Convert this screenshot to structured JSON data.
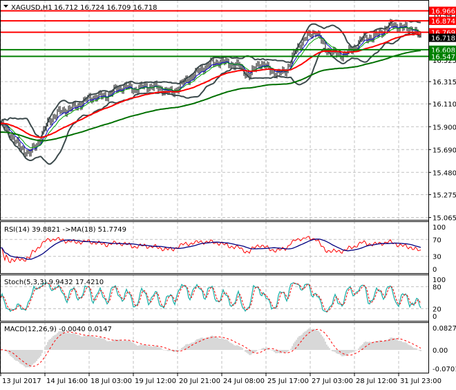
{
  "header": {
    "symbol": "XAGUSD,H1",
    "ohlc": "16.712 16.724 16.709 16.718",
    "menu_icon": "triangle-down-icon"
  },
  "colors": {
    "resistance": "#ff0000",
    "support": "#008000",
    "current_price_bg": "#000000",
    "bars": "#000000",
    "bollinger": "#3c4a4c",
    "ma_fast": "#ff0000",
    "ma_slow": "#007000",
    "rsi": "#ff0000",
    "rsi_ma": "#000080",
    "stoch_main": "#20b2aa",
    "stoch_signal": "#ff0000",
    "macd_hist": "#b0b0b0",
    "macd_signal": "#ff0000"
  },
  "price_axis": {
    "ticks": [
      "16.315",
      "16.110",
      "15.900",
      "15.690",
      "15.480",
      "15.275",
      "15.065"
    ],
    "hidden_ticks": [
      "16.945",
      "16.525"
    ]
  },
  "levels": [
    {
      "label": "16.966",
      "price": 16.966,
      "kind": "resistance"
    },
    {
      "label": "16.874",
      "price": 16.874,
      "kind": "resistance"
    },
    {
      "label": "16.769",
      "price": 16.769,
      "kind": "resistance"
    },
    {
      "label": "16.718",
      "price": 16.718,
      "kind": "current"
    },
    {
      "label": "16.608",
      "price": 16.608,
      "kind": "support"
    },
    {
      "label": "16.547",
      "price": 16.547,
      "kind": "support"
    }
  ],
  "time_axis": [
    "13 Jul 2017",
    "14 Jul 16:00",
    "18 Jul 03:00",
    "19 Jul 12:00",
    "20 Jul 21:00",
    "24 Jul 08:00",
    "25 Jul 17:00",
    "27 Jul 03:00",
    "28 Jul 12:00",
    "31 Jul 23:00"
  ],
  "rsi": {
    "label": "RSI(14) 39.8821  ->MA(18) 51.7749",
    "ticks": [
      "100",
      "70",
      "30",
      "0"
    ]
  },
  "stoch": {
    "label": "Stoch(5,3,3) 9.9432 17.4210",
    "ticks": [
      "100",
      "80",
      "20",
      "0"
    ]
  },
  "macd": {
    "label": "MACD(12,26,9) -0.0040 0.0147",
    "ticks": [
      "0.0827",
      "0.00",
      "-0.0701"
    ]
  },
  "chart_data": {
    "type": "ohlc",
    "symbol": "XAGUSD",
    "timeframe": "H1",
    "ylim": [
      15.065,
      16.966
    ],
    "grid": true,
    "close_samples": [
      15.93,
      15.83,
      15.71,
      15.65,
      15.77,
      15.95,
      16.03,
      16.06,
      16.09,
      16.15,
      16.18,
      16.18,
      16.24,
      16.27,
      16.24,
      16.27,
      16.27,
      16.24,
      16.21,
      16.3,
      16.36,
      16.43,
      16.48,
      16.5,
      16.48,
      16.46,
      16.36,
      16.49,
      16.44,
      16.38,
      16.43,
      16.62,
      16.72,
      16.78,
      16.62,
      16.57,
      16.56,
      16.62,
      16.72,
      16.72,
      16.78,
      16.84,
      16.81,
      16.8,
      16.72
    ]
  }
}
